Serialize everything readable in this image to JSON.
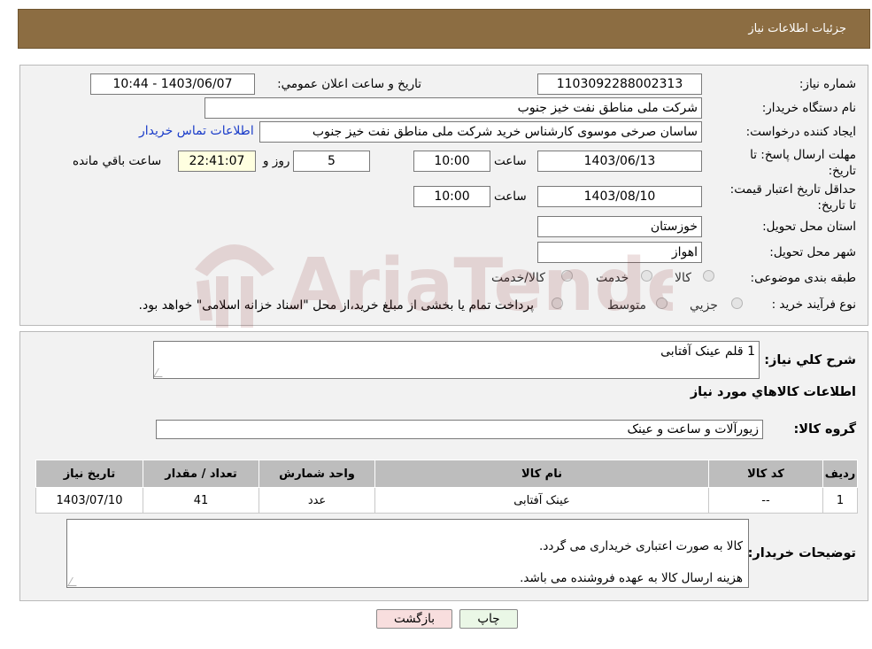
{
  "header": {
    "title": "جزئیات اطلاعات نیاز"
  },
  "details": {
    "need_number_label": "شماره نیاز:",
    "need_number": "1103092288002313",
    "announce_datetime_label": "تاریخ و ساعت اعلان عمومي:",
    "announce_datetime": "1403/06/07 - 10:44",
    "buyer_org_label": "نام دستگاه خريدار:",
    "buyer_org": "شرکت ملی مناطق نفت خیز جنوب",
    "requester_label": "ايجاد کننده درخواست:",
    "requester": "ساسان صرخی موسوی کارشناس خرید  شرکت ملی مناطق نفت خیز جنوب",
    "contact_link": "اطلاعات تماس خريدار",
    "reply_deadline_label": "مهلت ارسال پاسخ: تا تاريخ:",
    "reply_date": "1403/06/13",
    "time_label": "ساعت",
    "reply_time": "10:00",
    "days_value": "5",
    "days_label": "روز و",
    "remaining_time": "22:41:07",
    "remaining_label": "ساعت باقي مانده",
    "price_validity_label": "حداقل تاريخ اعتبار قيمت: تا تاريخ:",
    "validity_date": "1403/08/10",
    "validity_time_label": "ساعت",
    "validity_time": "10:00",
    "province_label": "استان محل تحويل:",
    "province": "خوزستان",
    "city_label": "شهر محل تحويل:",
    "city": "اهواز",
    "category_label": "طبقه بندی موضوعی:",
    "category_options": [
      "کالا",
      "خدمت",
      "کالا/خدمت"
    ],
    "process_label": "نوع فرآيند خريد :",
    "process_options": [
      "جزيي",
      "متوسط"
    ],
    "payment_note": "پرداخت تمام يا بخشی از مبلغ خريد،از محل \"اسناد خزانه اسلامی\" خواهد بود."
  },
  "summary": {
    "general_desc_label": "شرح کلي نياز:",
    "general_desc": "1 قلم عینک آفتابی",
    "goods_info_title": "اطلاعات کالاهاي مورد نياز",
    "goods_group_label": "گروه کالا:",
    "goods_group": "زیورآلات و ساعت و عینک"
  },
  "table": {
    "headers": [
      "رديف",
      "کد کالا",
      "نام کالا",
      "واحد شمارش",
      "تعداد / مقدار",
      "تاريخ نياز"
    ],
    "rows": [
      [
        "1",
        "--",
        "عینک آفتابی",
        "عدد",
        "41",
        "1403/07/10"
      ]
    ]
  },
  "buyer_notes": {
    "label": "توضيحات خريدار:",
    "line1": "کالا به صورت اعتباری خریداری می گردد.",
    "line2": "هزینه ارسال کالا به عهده فروشنده می باشد."
  },
  "buttons": {
    "print": "چاپ",
    "back": "بازگشت"
  },
  "watermark": {
    "text": "AriaTender.neT"
  },
  "colors": {
    "header_bg": "#8c6d42",
    "link": "#1a3cc9",
    "table_header": "#bdbdbd",
    "back_button_bg": "#f8dede",
    "print_button_bg": "#eaf7e6"
  }
}
